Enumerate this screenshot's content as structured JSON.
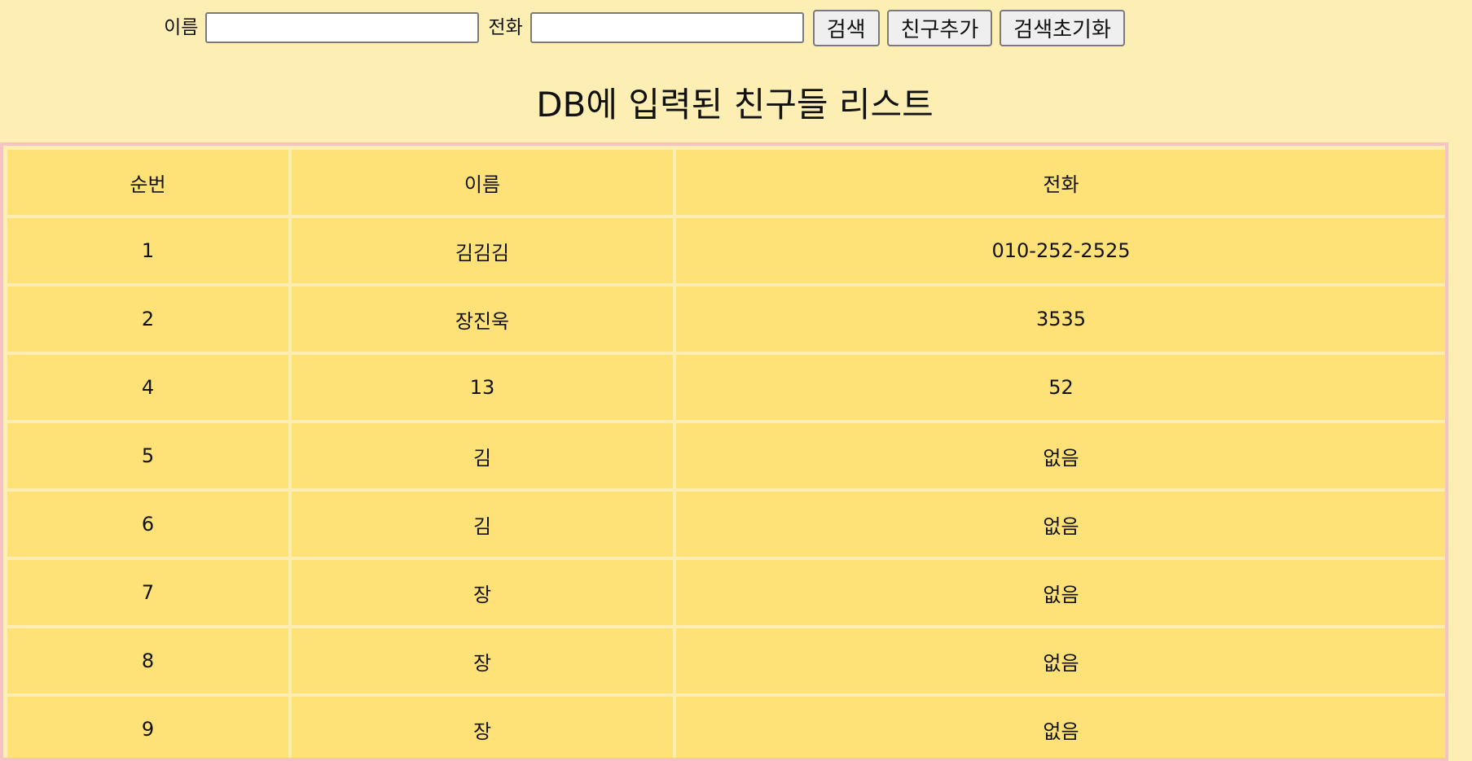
{
  "search": {
    "name_label": "이름",
    "name_value": "",
    "phone_label": "전화",
    "phone_value": "",
    "search_button": "검색",
    "add_friend_button": "친구추가",
    "reset_button": "검색초기화"
  },
  "page": {
    "title": "DB에 입력된 친구들 리스트"
  },
  "table": {
    "headers": [
      "순번",
      "이름",
      "전화"
    ],
    "rows": [
      [
        "1",
        "김김김",
        "010-252-2525"
      ],
      [
        "2",
        "장진욱",
        "3535"
      ],
      [
        "4",
        "13",
        "52"
      ],
      [
        "5",
        "김",
        "없음"
      ],
      [
        "6",
        "김",
        "없음"
      ],
      [
        "7",
        "장",
        "없음"
      ],
      [
        "8",
        "장",
        "없음"
      ],
      [
        "9",
        "장",
        "없음"
      ]
    ]
  },
  "colors": {
    "page_bg": "#fdefb3",
    "cell_bg": "#fee177",
    "table_border": "#f7c2c6"
  }
}
